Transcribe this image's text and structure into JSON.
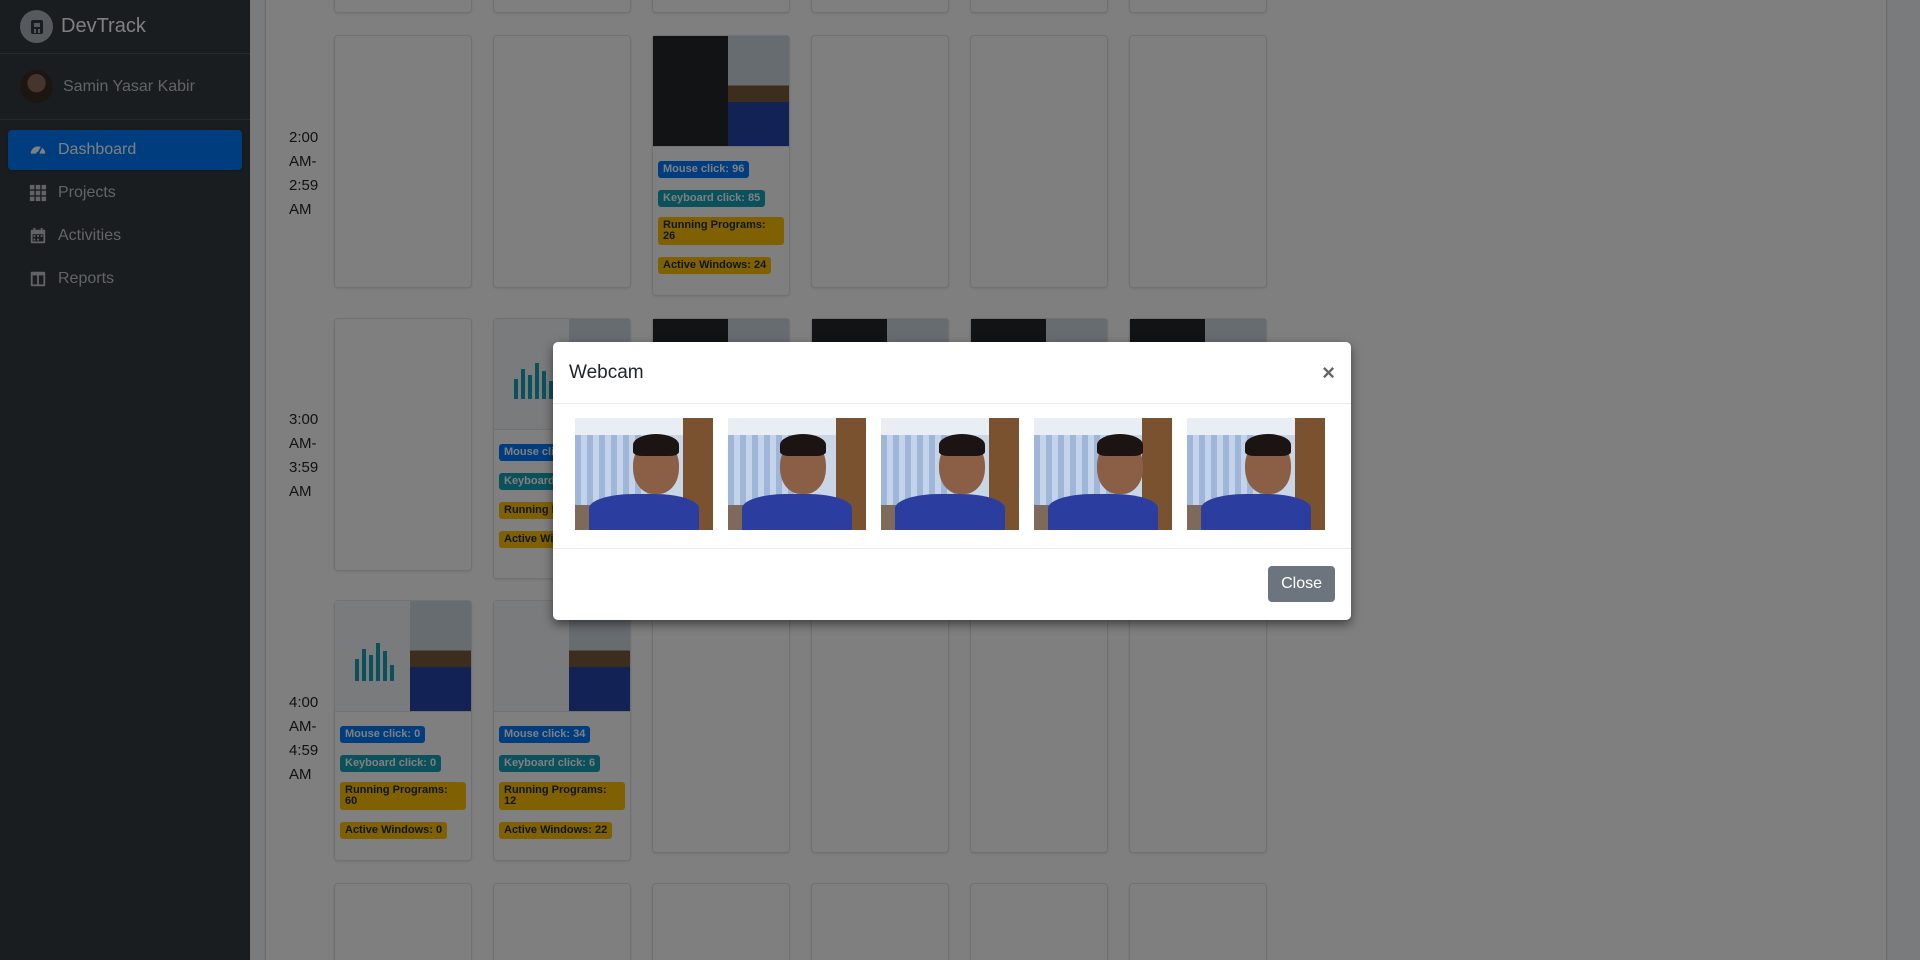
{
  "brand": {
    "name": "DevTrack"
  },
  "user": {
    "name": "Samin Yasar Kabir"
  },
  "sidebar": {
    "items": [
      {
        "label": "Dashboard",
        "icon": "tachometer-icon",
        "active": true
      },
      {
        "label": "Projects",
        "icon": "grid-icon"
      },
      {
        "label": "Activities",
        "icon": "calendar-icon"
      },
      {
        "label": "Reports",
        "icon": "columns-icon"
      }
    ]
  },
  "hours": [
    {
      "label_lines": [
        "2:00",
        "AM-",
        "2:59",
        "AM"
      ]
    },
    {
      "label_lines": [
        "3:00",
        "AM-",
        "3:59",
        "AM"
      ]
    },
    {
      "label_lines": [
        "4:00",
        "AM-",
        "4:59",
        "AM"
      ]
    }
  ],
  "slots": {
    "h2_c3": {
      "mouse": "Mouse click: 96",
      "keyboard": "Keyboard click: 85",
      "programs": "Running Programs: 26",
      "windows": "Active Windows: 24"
    },
    "h3_c2": {
      "mouse": "Mouse clic",
      "keyboard": "Keyboard",
      "programs": "Running P",
      "windows": "Active Wi"
    },
    "h4_c1": {
      "mouse": "Mouse click: 0",
      "keyboard": "Keyboard click: 0",
      "programs": "Running Programs: 60",
      "windows": "Active Windows: 0"
    },
    "h4_c2": {
      "mouse": "Mouse click: 34",
      "keyboard": "Keyboard click: 6",
      "programs": "Running Programs: 12",
      "windows": "Active Windows: 22"
    }
  },
  "modal": {
    "title": "Webcam",
    "close_symbol": "×",
    "close_button": "Close",
    "image_count": 5
  },
  "colors": {
    "sidebar_bg": "#343a40",
    "active_nav": "#007bff",
    "badge_primary": "#007bff",
    "badge_info": "#17a2b8",
    "badge_warning": "#ffc107",
    "close_btn": "#6c757d"
  }
}
